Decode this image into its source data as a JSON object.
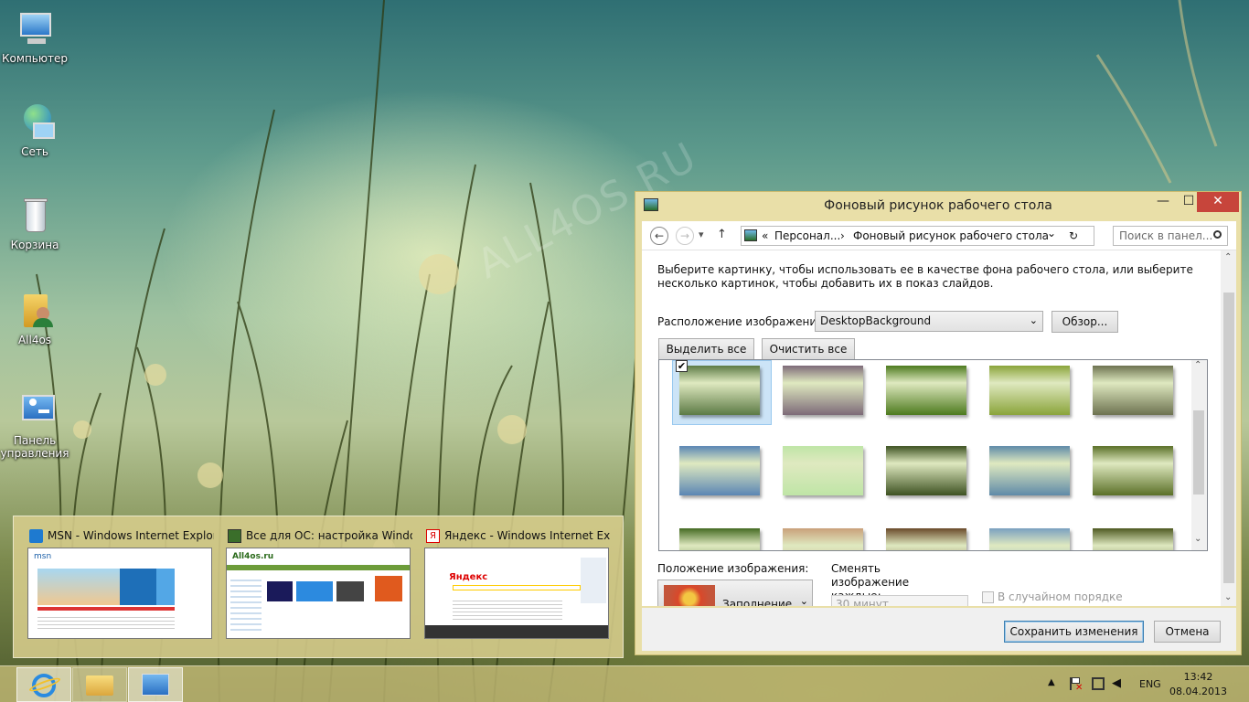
{
  "desktop": {
    "icons": [
      {
        "label": "Компьютер"
      },
      {
        "label": "Сеть"
      },
      {
        "label": "Корзина"
      },
      {
        "label": "All4os"
      },
      {
        "label": "Панель управления"
      }
    ],
    "watermark": "ALL4OS.RU"
  },
  "thumbnails": [
    {
      "title": "MSN - Windows Internet Explorer",
      "site": "msn"
    },
    {
      "title": "Все для ОС: настройка Windo...",
      "site": "All4os.ru"
    },
    {
      "title": "Яндекс - Windows Internet Expl...",
      "site": "Яндекс"
    }
  ],
  "window": {
    "title": "Фоновый рисунок рабочего стола",
    "min_label": "—",
    "max_label": "☐",
    "close_label": "✕",
    "nav": {
      "back": "←",
      "forward": "→",
      "dropdown": "▾",
      "up": "↑",
      "breadcrumb_prefix": "«",
      "crumb_1": "Персонал...",
      "crumb_sep": "›",
      "crumb_2": "Фоновый рисунок рабочего стола",
      "addr_dropdown": "⌄",
      "refresh": "↻",
      "search_placeholder": "Поиск в панел..."
    },
    "description": "Выберите картинку, чтобы использовать ее в качестве фона рабочего стола, или выберите несколько картинок, чтобы добавить их в показ слайдов.",
    "location_label": "Расположение изображения:",
    "location_value": "DesktopBackground",
    "browse_label": "Обзор...",
    "select_all_label": "Выделить все",
    "clear_all_label": "Очистить все",
    "checkmark": "✔",
    "position_label": "Положение изображения:",
    "position_value": "Заполнение",
    "interval_label": "Сменять изображение каждые:",
    "interval_value": "30 минут",
    "shuffle_label": "В случайном порядке",
    "save_label": "Сохранить изменения",
    "cancel_label": "Отмена",
    "tile_colors": [
      [
        "#5c7a45",
        "#7d6a78",
        "#4d7a1e",
        "#8aa43a",
        "#6d7250"
      ],
      [
        "#5b86b4",
        "#bfe5a6",
        "#3e5222",
        "#5f8aa8",
        "#5b7028"
      ],
      [
        "#456b23",
        "#c9a07a",
        "#6a4a2a",
        "#7aa0c0",
        "#4f5a22"
      ]
    ]
  },
  "taskbar": {
    "lang": "ENG",
    "time": "13:42",
    "date": "08.04.2013"
  }
}
